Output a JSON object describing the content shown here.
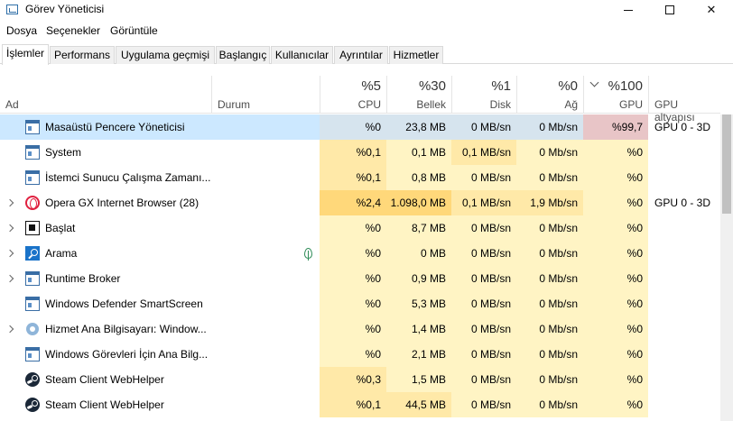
{
  "window": {
    "title": "Görev Yöneticisi"
  },
  "menu": [
    "Dosya",
    "Seçenekler",
    "Görüntüle"
  ],
  "tabs": [
    "İşlemler",
    "Performans",
    "Uygulama geçmişi",
    "Başlangıç",
    "Kullanıcılar",
    "Ayrıntılar",
    "Hizmetler"
  ],
  "active_tab": "İşlemler",
  "columns": {
    "name": "Ad",
    "status": "Durum",
    "cpu": {
      "pct": "%5",
      "label": "CPU"
    },
    "memory": {
      "pct": "%30",
      "label": "Bellek"
    },
    "disk": {
      "pct": "%1",
      "label": "Disk"
    },
    "network": {
      "pct": "%0",
      "label": "Ağ"
    },
    "gpu": {
      "pct": "%100",
      "label": "GPU"
    },
    "gpu_engine": "GPU altyapısı"
  },
  "rows": [
    {
      "name": "Masaüstü Pencere Yöneticisi",
      "icon": "window-icon",
      "expandable": false,
      "selected": true,
      "status": "",
      "cpu": "%0",
      "memory": "23,8 MB",
      "disk": "0 MB/sn",
      "network": "0 Mb/sn",
      "gpu": "%99,7",
      "gpu_engine": "GPU 0 - 3D"
    },
    {
      "name": "System",
      "icon": "window-icon",
      "expandable": false,
      "status": "",
      "cpu": "%0,1",
      "memory": "0,1 MB",
      "disk": "0,1 MB/sn",
      "network": "0 Mb/sn",
      "gpu": "%0",
      "gpu_engine": ""
    },
    {
      "name": "İstemci Sunucu Çalışma Zamanı...",
      "icon": "window-icon",
      "expandable": false,
      "status": "",
      "cpu": "%0,1",
      "memory": "0,8 MB",
      "disk": "0 MB/sn",
      "network": "0 Mb/sn",
      "gpu": "%0",
      "gpu_engine": ""
    },
    {
      "name": "Opera GX Internet Browser (28)",
      "icon": "opera-icon",
      "expandable": true,
      "status": "",
      "cpu": "%2,4",
      "memory": "1.098,0 MB",
      "disk": "0,1 MB/sn",
      "network": "1,9 Mb/sn",
      "gpu": "%0",
      "gpu_engine": "GPU 0 - 3D"
    },
    {
      "name": "Başlat",
      "icon": "start-icon",
      "expandable": true,
      "status": "",
      "cpu": "%0",
      "memory": "8,7 MB",
      "disk": "0 MB/sn",
      "network": "0 Mb/sn",
      "gpu": "%0",
      "gpu_engine": ""
    },
    {
      "name": "Arama",
      "icon": "search-icon",
      "expandable": true,
      "status": "",
      "status_icon": "leaf-icon",
      "cpu": "%0",
      "memory": "0 MB",
      "disk": "0 MB/sn",
      "network": "0 Mb/sn",
      "gpu": "%0",
      "gpu_engine": ""
    },
    {
      "name": "Runtime Broker",
      "icon": "window-icon",
      "expandable": true,
      "status": "",
      "cpu": "%0",
      "memory": "0,9 MB",
      "disk": "0 MB/sn",
      "network": "0 Mb/sn",
      "gpu": "%0",
      "gpu_engine": ""
    },
    {
      "name": "Windows Defender SmartScreen",
      "icon": "window-icon",
      "expandable": false,
      "status": "",
      "cpu": "%0",
      "memory": "5,3 MB",
      "disk": "0 MB/sn",
      "network": "0 Mb/sn",
      "gpu": "%0",
      "gpu_engine": ""
    },
    {
      "name": "Hizmet Ana Bilgisayarı: Window...",
      "icon": "gear-icon",
      "expandable": true,
      "status": "",
      "cpu": "%0",
      "memory": "1,4 MB",
      "disk": "0 MB/sn",
      "network": "0 Mb/sn",
      "gpu": "%0",
      "gpu_engine": ""
    },
    {
      "name": "Windows Görevleri İçin Ana Bilg...",
      "icon": "window-icon",
      "expandable": false,
      "status": "",
      "cpu": "%0",
      "memory": "2,1 MB",
      "disk": "0 MB/sn",
      "network": "0 Mb/sn",
      "gpu": "%0",
      "gpu_engine": ""
    },
    {
      "name": "Steam Client WebHelper",
      "icon": "steam-icon",
      "expandable": false,
      "status": "",
      "cpu": "%0,3",
      "memory": "1,5 MB",
      "disk": "0 MB/sn",
      "network": "0 Mb/sn",
      "gpu": "%0",
      "gpu_engine": ""
    },
    {
      "name": "Steam Client WebHelper",
      "icon": "steam-icon",
      "expandable": false,
      "status": "",
      "cpu": "%0,1",
      "memory": "44,5 MB",
      "disk": "0 MB/sn",
      "network": "0 Mb/sn",
      "gpu": "%0",
      "gpu_engine": ""
    }
  ],
  "heat_colors": {
    "light": "#fff4c4",
    "medium": "#ffe9a8",
    "strong": "#ffd87a",
    "gpu_high": "#e8c5c7",
    "selected_row": "#cce8ff",
    "selected_heat": "#d6e4ee"
  }
}
